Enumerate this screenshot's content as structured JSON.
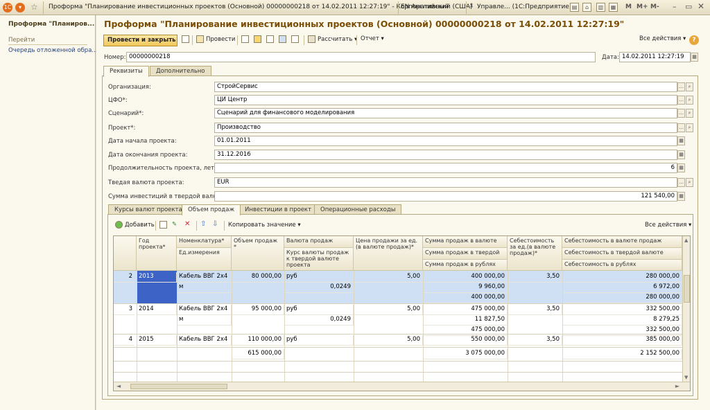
{
  "window": {
    "title": "Проформа \"Планирование инвестиционных проектов (Основной) 00000000218 от 14.02.2011 12:27:19\" - Корпоративный",
    "language": "EN Английский (США)",
    "app_task": "Управле... (1С:Предприятие)",
    "m_buttons": [
      "M",
      "M+",
      "M-"
    ]
  },
  "left_panel": {
    "title": "Проформа \"Планиров...",
    "goto_label": "Перейти",
    "queue_link": "Очередь отложенной обра..."
  },
  "document": {
    "title": "Проформа \"Планирование инвестиционных проектов  (Основной)  00000000218 от 14.02.2011 12:27:19\"",
    "toolbar": {
      "post_close": "Провести и закрыть",
      "post": "Провести",
      "calculate": "Рассчитать",
      "report": "Отчет",
      "all_actions": "Все действия"
    },
    "number_label": "Номер:",
    "number_value": "00000000218",
    "date_label": "Дата:",
    "date_value": "14.02.2011 12:27:19"
  },
  "tabs": [
    "Реквизиты",
    "Дополнительно"
  ],
  "fields": [
    {
      "label": "Организация:",
      "value": "СтройСервис"
    },
    {
      "label": "ЦФО*:",
      "value": "ЦИ Центр"
    },
    {
      "label": "Сценарий*:",
      "value": "Сценарий для финансового моделирования"
    },
    {
      "label": "Проект*:",
      "value": "Производство"
    },
    {
      "label": "Дата начала проекта:",
      "value": "01.01.2011"
    },
    {
      "label": "Дата окончания проекта:",
      "value": "31.12.2016"
    },
    {
      "label": "Продолжительность проекта, лет:",
      "value": "6"
    },
    {
      "label": "Тведая валюта проекта:",
      "value": "EUR"
    },
    {
      "label": "Сумма инвестиций в твердой валюте:",
      "value": "121 540,00"
    }
  ],
  "subtabs": [
    "Курсы валют проекта",
    "Объем продаж",
    "Инвестиции  в проект",
    "Операционные расходы"
  ],
  "table_toolbar": {
    "add": "Добавить",
    "copy_value": "Копировать значение",
    "all_actions": "Все действия"
  },
  "table": {
    "headers": {
      "year": "Год проекта*",
      "item": "Номенклатура*",
      "unit": "Ед.измерения",
      "volume": "Объем продаж *",
      "currency": "Валюта продаж",
      "rate": "Курс валюты продаж к твердой валюте проекта",
      "price": "Цена продажи за ед.(в валюте продаж)*",
      "sum_cur": "Сумма продаж в валюте",
      "sum_hard": "Сумма продаж в твердой ...",
      "sum_rub": "Сумма продаж в рублях",
      "cost_unit": "Себестоимость за ед.(в валюте продаж)*",
      "cost_cur": "Себестоимость в валюте продаж",
      "cost_hard": "Себестоимость в твердой валюте",
      "cost_rub": "Себестоимость в рублях"
    },
    "rows": [
      {
        "n": "2",
        "year": "2013",
        "item": "Кабель ВВГ 2х4",
        "unit": "м",
        "volume": "80 000,00",
        "currency": "руб",
        "rate": "0,0249",
        "price": "5,00",
        "sum_cur": "400 000,00",
        "sum_hard": "9 960,00",
        "sum_rub": "400 000,00",
        "cost_unit": "3,50",
        "cost_cur": "280 000,00",
        "cost_hard": "6 972,00",
        "cost_rub": "280 000,00"
      },
      {
        "n": "3",
        "year": "2014",
        "item": "Кабель ВВГ 2х4",
        "unit": "м",
        "volume": "95 000,00",
        "currency": "руб",
        "rate": "0,0249",
        "price": "5,00",
        "sum_cur": "475 000,00",
        "sum_hard": "11 827,50",
        "sum_rub": "475 000,00",
        "cost_unit": "3,50",
        "cost_cur": "332 500,00",
        "cost_hard": "8 279,25",
        "cost_rub": "332 500,00"
      },
      {
        "n": "4",
        "year": "2015",
        "item": "Кабель ВВГ 2х4",
        "unit": "",
        "volume": "110 000,00",
        "currency": "руб",
        "rate": "",
        "price": "5,00",
        "sum_cur": "550 000,00",
        "sum_hard": "",
        "sum_rub": "",
        "cost_unit": "3,50",
        "cost_cur": "385 000,00",
        "cost_hard": "",
        "cost_rub": ""
      }
    ],
    "totals": {
      "volume": "615 000,00",
      "sum_cur": "3 075 000,00",
      "cost_cur": "2 152 500,00"
    }
  }
}
